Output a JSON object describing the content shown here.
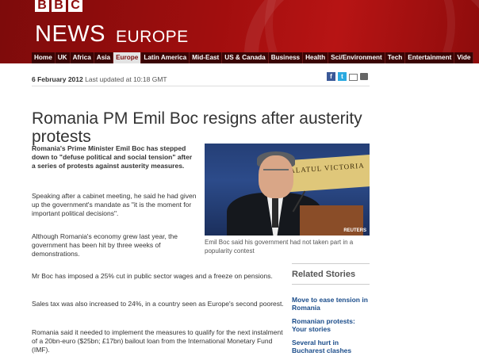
{
  "masthead": {
    "bbc_letters": [
      "B",
      "B",
      "C"
    ],
    "news": "NEWS",
    "edition": "EUROPE"
  },
  "nav": [
    "Home",
    "UK",
    "Africa",
    "Asia",
    "Europe",
    "Latin America",
    "Mid-East",
    "US & Canada",
    "Business",
    "Health",
    "Sci/Environment",
    "Tech",
    "Entertainment",
    "Vide"
  ],
  "nav_active": "Europe",
  "article": {
    "date": "6 February 2012",
    "updated": "Last updated at 10:18 GMT",
    "headline": "Romania PM Emil Boc resigns after austerity protests",
    "paragraphs": [
      "Romania's Prime Minister Emil Boc has stepped down to \"defuse political and social tension\" after a series of protests against austerity measures.",
      "Speaking after a cabinet meeting, he said he had given up the government's mandate as \"it is the moment for important political decisions\".",
      "Although Romania's economy grew last year, the government has been hit by three weeks of demonstrations.",
      "Mr Boc has imposed a 25% cut in public sector wages and a freeze on pensions.",
      "Sales tax was also increased to 24%, in a country seen as Europe's second poorest.",
      "Romania said it needed to implement the measures to qualify for the next instalment of a 20bn-euro ($25bn; £17bn) bailout loan from the International Monetary Fund (IMF)."
    ],
    "image_sign": "PALATUL VICTORIA",
    "image_credit": "REUTERS",
    "caption": "Emil Boc said his government had not taken part in a popularity contest"
  },
  "share_icons": [
    "facebook-icon",
    "twitter-icon",
    "email-icon",
    "print-icon"
  ],
  "related": {
    "title": "Related Stories",
    "items": [
      "Move to ease tension in Romania",
      "Romanian protests: Your stories",
      "Several hurt in Bucharest clashes"
    ]
  },
  "colors": {
    "brand_red": "#a10e0e",
    "link_blue": "#1a4c8a"
  }
}
